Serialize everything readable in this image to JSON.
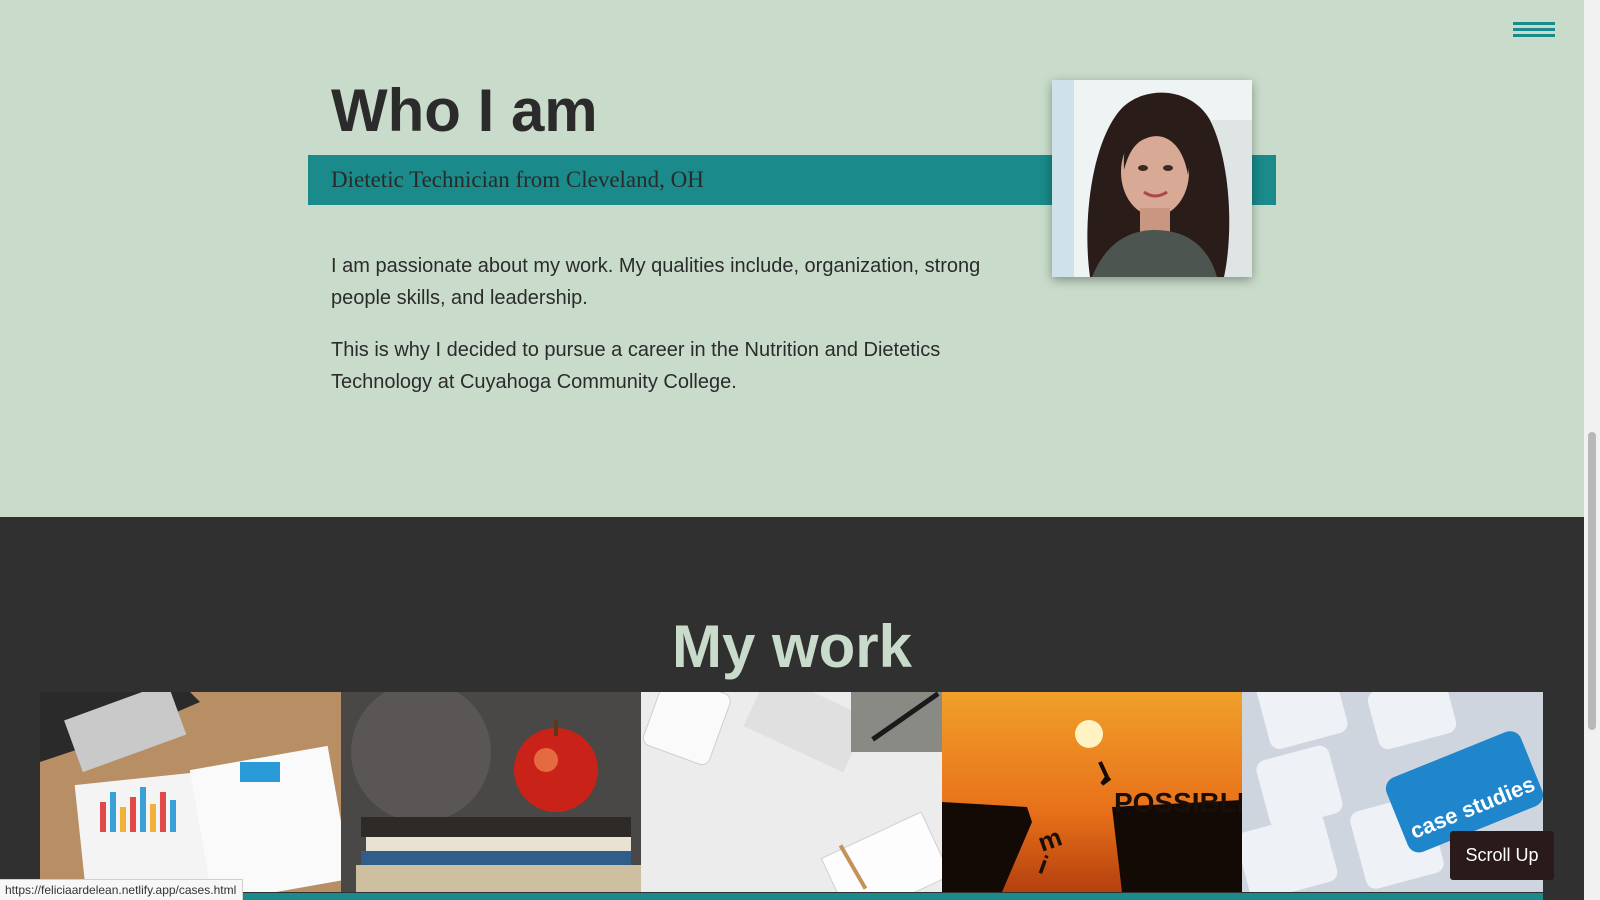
{
  "menu": {
    "icon": "hamburger-menu-icon"
  },
  "about": {
    "title": "Who I am",
    "subtitle": "Dietetic Technician from Cleveland, OH",
    "paragraphs": [
      "I am passionate about my work. My qualities include, organization, strong people skills, and leadership.",
      "This is why I decided to pursue a career in the Nutrition and Dietetics Technology at Cuyahoga Community College."
    ]
  },
  "work": {
    "title": "My work",
    "tiles": [
      {
        "name": "work-tile-reports"
      },
      {
        "name": "work-tile-apple-books"
      },
      {
        "name": "work-tile-desk"
      },
      {
        "name": "work-tile-impossible",
        "image_text": "POSSIBLE"
      },
      {
        "name": "work-tile-case-studies",
        "image_text": "case studies"
      }
    ]
  },
  "scroll_up": "Scroll Up",
  "status_url": "https://feliciaardelean.netlify.app/cases.html",
  "colors": {
    "mint": "#c9dccb",
    "teal": "#1a8a8a",
    "dark": "#303030",
    "text": "#2b2b2b"
  }
}
